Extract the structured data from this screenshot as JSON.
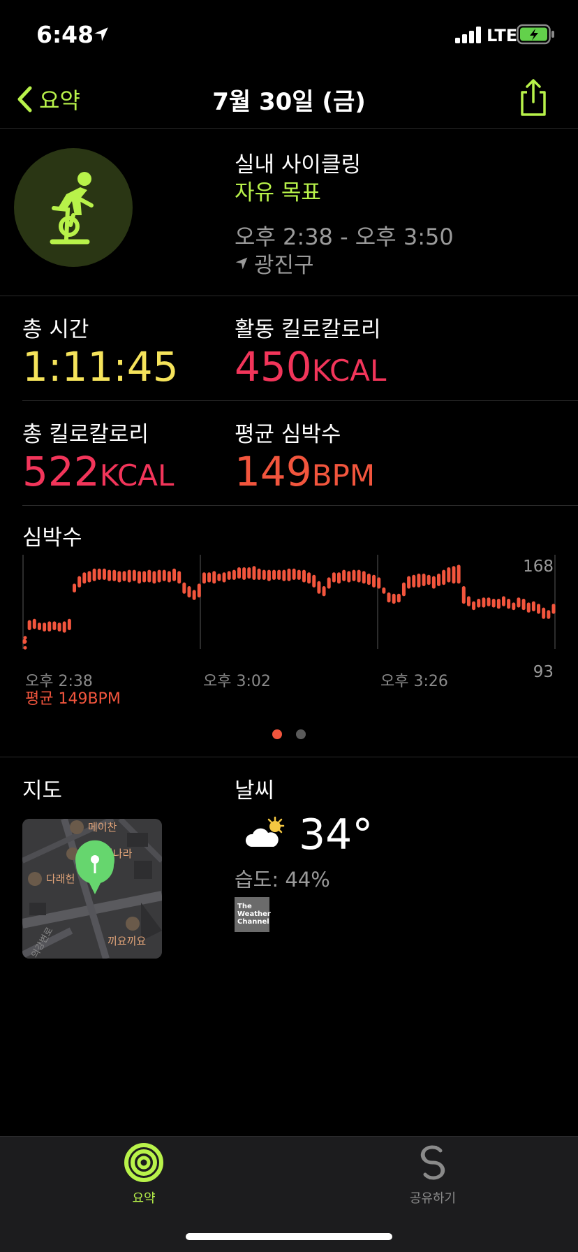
{
  "status": {
    "time": "6:48",
    "network": "LTE"
  },
  "nav": {
    "back_label": "요약",
    "title": "7월 30일 (금)"
  },
  "workout": {
    "name": "실내 사이클링",
    "goal": "자유 목표",
    "time_range": "오후 2:38 - 오후 3:50",
    "location": "광진구"
  },
  "metrics": {
    "total_time": {
      "label": "총 시간",
      "value": "1:11:45"
    },
    "active_kcal": {
      "label": "활동 킬로칼로리",
      "value": "450",
      "unit": "KCAL"
    },
    "total_kcal": {
      "label": "총 킬로칼로리",
      "value": "522",
      "unit": "KCAL"
    },
    "avg_hr": {
      "label": "평균 심박수",
      "value": "149",
      "unit": "BPM"
    }
  },
  "heart_rate": {
    "title": "심박수",
    "avg_label": "평균 149BPM",
    "y_max_label": "168",
    "y_min_label": "93",
    "x_labels": [
      "오후 2:38",
      "오후 3:02",
      "오후 3:26"
    ]
  },
  "map": {
    "title": "지도",
    "places": [
      "메이찬",
      "어나라",
      "다래헌",
      "끼요끼요",
      "의강변로"
    ]
  },
  "weather": {
    "title": "날씨",
    "temperature": "34°",
    "humidity": "습도: 44%",
    "provider_lines": [
      "The",
      "Weather",
      "Channel"
    ]
  },
  "tabs": [
    {
      "label": "요약",
      "active": true
    },
    {
      "label": "공유하기",
      "active": false
    }
  ],
  "colors": {
    "accent_green": "#b8f24a",
    "time_yellow": "#f5e35b",
    "kcal_pink": "#f2355a",
    "hr_red": "#f2553d"
  },
  "chart_data": {
    "type": "bar",
    "title": "심박수",
    "ylim": [
      93,
      168
    ],
    "y_ticks": [
      93,
      168
    ],
    "x_tick_labels": [
      "오후 2:38",
      "오후 3:02",
      "오후 3:26"
    ],
    "xlim_minutes_from_start": [
      0,
      72
    ],
    "grid": true,
    "series": [
      {
        "values": [
          [
            97,
            101
          ],
          [
            108,
            116
          ],
          [
            109,
            117
          ],
          [
            108,
            114
          ],
          [
            107,
            114
          ],
          [
            107,
            115
          ],
          [
            108,
            115
          ],
          [
            107,
            114
          ],
          [
            106,
            115
          ],
          [
            108,
            117
          ],
          [
            138,
            145
          ],
          [
            142,
            151
          ],
          [
            145,
            154
          ],
          [
            146,
            155
          ],
          [
            147,
            157
          ],
          [
            148,
            157
          ],
          [
            148,
            157
          ],
          [
            147,
            156
          ],
          [
            147,
            156
          ],
          [
            146,
            155
          ],
          [
            147,
            155
          ],
          [
            146,
            156
          ],
          [
            147,
            156
          ],
          [
            145,
            155
          ],
          [
            146,
            155
          ],
          [
            146,
            156
          ],
          [
            145,
            155
          ],
          [
            146,
            156
          ],
          [
            147,
            156
          ],
          [
            146,
            155
          ],
          [
            147,
            157
          ],
          [
            145,
            155
          ],
          [
            137,
            146
          ],
          [
            134,
            143
          ],
          [
            132,
            140
          ],
          [
            134,
            145
          ],
          [
            145,
            154
          ],
          [
            146,
            154
          ],
          [
            145,
            155
          ],
          [
            147,
            153
          ],
          [
            146,
            154
          ],
          [
            148,
            155
          ],
          [
            148,
            156
          ],
          [
            149,
            158
          ],
          [
            148,
            158
          ],
          [
            149,
            158
          ],
          [
            148,
            159
          ],
          [
            148,
            157
          ],
          [
            148,
            156
          ],
          [
            147,
            156
          ],
          [
            148,
            156
          ],
          [
            148,
            156
          ],
          [
            147,
            156
          ],
          [
            147,
            157
          ],
          [
            148,
            157
          ],
          [
            148,
            156
          ],
          [
            146,
            156
          ],
          [
            145,
            154
          ],
          [
            142,
            152
          ],
          [
            137,
            147
          ],
          [
            135,
            143
          ],
          [
            141,
            150
          ],
          [
            146,
            154
          ],
          [
            145,
            154
          ],
          [
            147,
            156
          ],
          [
            146,
            155
          ],
          [
            147,
            156
          ],
          [
            146,
            156
          ],
          [
            145,
            155
          ],
          [
            144,
            153
          ],
          [
            142,
            152
          ],
          [
            141,
            150
          ],
          [
            137,
            142
          ],
          [
            130,
            138
          ],
          [
            129,
            137
          ],
          [
            130,
            137
          ],
          [
            135,
            146
          ],
          [
            141,
            151
          ],
          [
            142,
            152
          ],
          [
            142,
            153
          ],
          [
            143,
            153
          ],
          [
            144,
            152
          ],
          [
            141,
            151
          ],
          [
            143,
            153
          ],
          [
            144,
            156
          ],
          [
            146,
            158
          ],
          [
            145,
            159
          ],
          [
            145,
            160
          ],
          [
            129,
            143
          ],
          [
            127,
            135
          ],
          [
            124,
            131
          ],
          [
            126,
            133
          ],
          [
            126,
            134
          ],
          [
            127,
            134
          ],
          [
            126,
            133
          ],
          [
            125,
            133
          ],
          [
            127,
            135
          ],
          [
            125,
            133
          ],
          [
            124,
            130
          ],
          [
            126,
            134
          ],
          [
            124,
            133
          ],
          [
            122,
            130
          ],
          [
            123,
            131
          ],
          [
            121,
            129
          ],
          [
            117,
            126
          ],
          [
            117,
            124
          ],
          [
            121,
            129
          ]
        ]
      }
    ]
  }
}
